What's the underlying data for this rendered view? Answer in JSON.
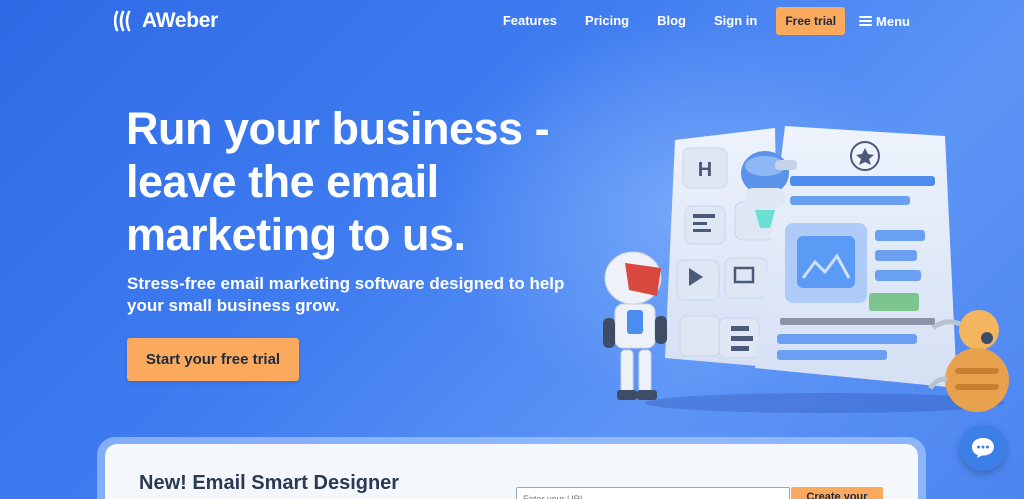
{
  "brand": {
    "name": "AWeber",
    "logo_icon": "aweber-waves-icon"
  },
  "nav": {
    "links": [
      {
        "label": "Features"
      },
      {
        "label": "Pricing"
      },
      {
        "label": "Blog"
      },
      {
        "label": "Sign in"
      }
    ],
    "trial_label": "Free trial",
    "menu_label": "Menu",
    "menu_icon": "hamburger-icon"
  },
  "hero": {
    "headline": "Run your business - leave the email marketing to us.",
    "subheadline": "Stress-free email marketing software designed to help your small business grow.",
    "cta_label": "Start your free trial",
    "illustration_icon": "robots-email-builder-illustration",
    "tile_letter": "H"
  },
  "smart_designer": {
    "title": "New! Email Smart Designer",
    "url_placeholder": "Enter your URL",
    "create_label": "Create your"
  },
  "chat": {
    "icon": "chat-bubble-icon"
  },
  "colors": {
    "accent": "#fba95c",
    "background": "#3f7cf0",
    "text_dark": "#2b3a52"
  }
}
